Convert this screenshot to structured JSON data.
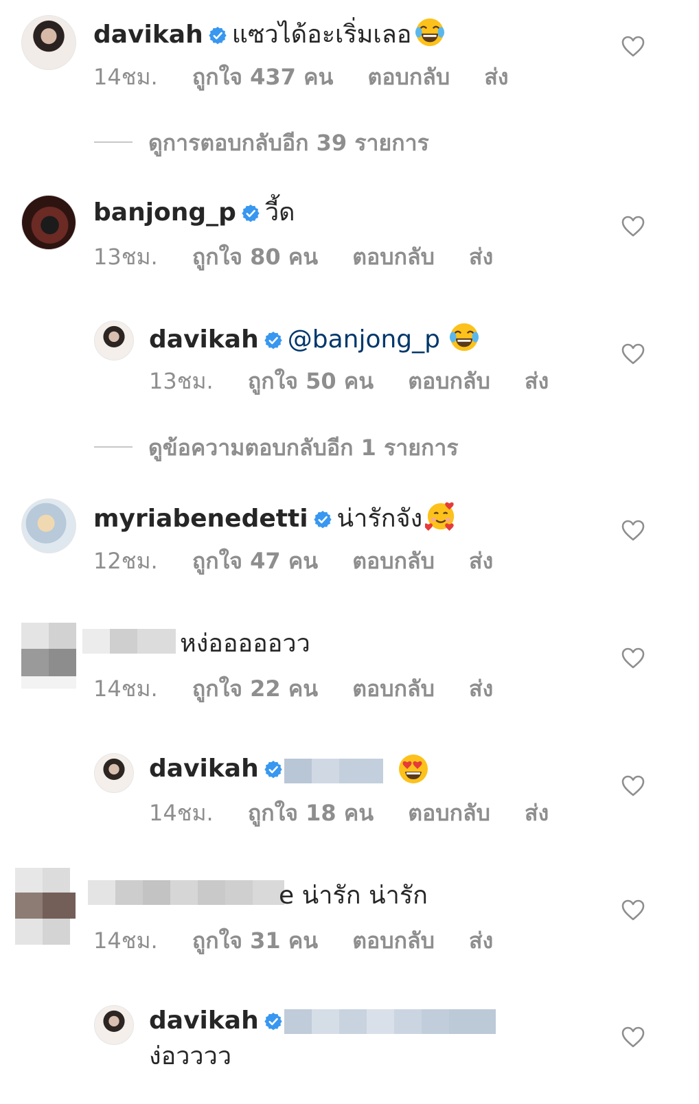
{
  "comments": [
    {
      "username": "davikah",
      "text": "แซวได้อะเริ่มเลอ",
      "emoji": "face-with-tears-of-joy",
      "time": "14ชม.",
      "likes": "ถูกใจ 437 คน",
      "reply": "ตอบกลับ",
      "send": "ส่ง"
    },
    {
      "username": "banjong_p",
      "text": "วี้ด",
      "time": "13ชม.",
      "likes": "ถูกใจ 80 คน",
      "reply": "ตอบกลับ",
      "send": "ส่ง"
    },
    {
      "username": "davikah",
      "mention": "@banjong_p",
      "emoji": "face-with-tears-of-joy",
      "time": "13ชม.",
      "likes": "ถูกใจ 50 คน",
      "reply": "ตอบกลับ",
      "send": "ส่ง"
    },
    {
      "username": "myriabenedetti",
      "text": "น่ารักจัง",
      "emoji": "smiling-face-with-hearts",
      "time": "12ชม.",
      "likes": "ถูกใจ 47 คน",
      "reply": "ตอบกลับ",
      "send": "ส่ง"
    },
    {
      "text": "หง่อออออวว",
      "time": "14ชม.",
      "likes": "ถูกใจ 22 คน",
      "reply": "ตอบกลับ",
      "send": "ส่ง"
    },
    {
      "username": "davikah",
      "emoji": "heart-eyes",
      "time": "14ชม.",
      "likes": "ถูกใจ 18 คน",
      "reply": "ตอบกลับ",
      "send": "ส่ง"
    },
    {
      "text": "e น่ารัก น่ารัก",
      "time": "14ชม.",
      "likes": "ถูกใจ 31 คน",
      "reply": "ตอบกลับ",
      "send": "ส่ง"
    },
    {
      "username": "davikah",
      "text": "ง่อวววว"
    }
  ],
  "view_replies": [
    "ดูการตอบกลับอีก 39 รายการ",
    "ดูข้อความตอบกลับอีก 1 รายการ"
  ],
  "colors": {
    "verified": "#3897f0",
    "mention": "#00376b",
    "meta": "#8e8e8e"
  }
}
